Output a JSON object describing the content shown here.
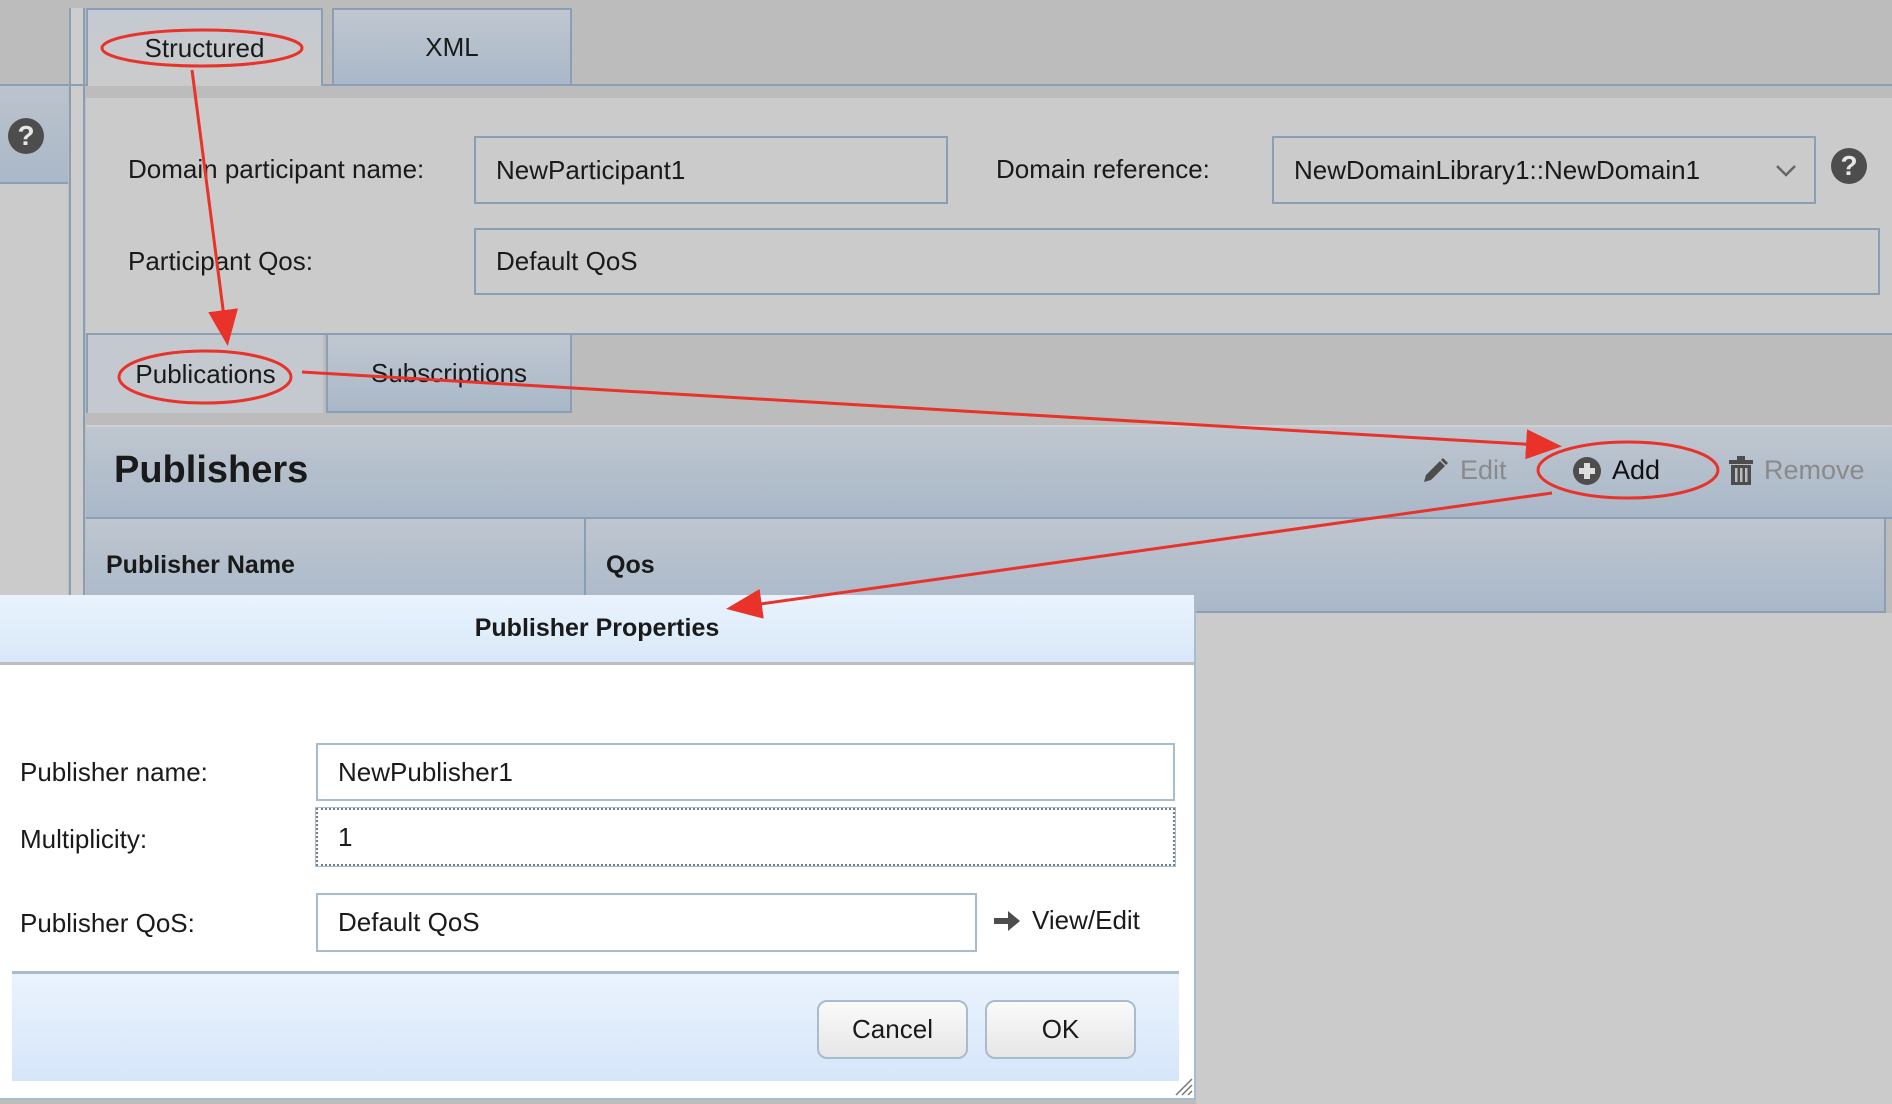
{
  "top_tabs": [
    {
      "label": "Structured",
      "active": true
    },
    {
      "label": "XML",
      "active": false
    }
  ],
  "form": {
    "participant_name_label": "Domain participant name:",
    "participant_name_value": "NewParticipant1",
    "domain_reference_label": "Domain reference:",
    "domain_reference_value": "NewDomainLibrary1::NewDomain1",
    "participant_qos_label": "Participant Qos:",
    "participant_qos_value": "Default QoS"
  },
  "sub_tabs": [
    {
      "label": "Publications",
      "active": true
    },
    {
      "label": "Subscriptions",
      "active": false
    }
  ],
  "publishers": {
    "title": "Publishers",
    "toolbar": {
      "edit": "Edit",
      "add": "Add",
      "remove": "Remove"
    },
    "columns": [
      "Publisher Name",
      "Qos"
    ]
  },
  "dialog": {
    "title": "Publisher Properties",
    "publisher_name_label": "Publisher name:",
    "publisher_name_value": "NewPublisher1",
    "multiplicity_label": "Multiplicity:",
    "multiplicity_value": "1",
    "publisher_qos_label": "Publisher QoS:",
    "publisher_qos_value": "Default QoS",
    "view_edit_label": "View/Edit",
    "cancel_label": "Cancel",
    "ok_label": "OK"
  },
  "icons": {
    "help": "?",
    "edit": "pencil-icon",
    "add": "plus-circle-icon",
    "remove": "trash-icon",
    "dropdown": "chevron-down-icon",
    "view_edit": "arrow-right-icon"
  },
  "colors": {
    "annotation": "#e8322a",
    "tab_border": "#8a9fb3",
    "dialog_header": "#e2eefb"
  }
}
